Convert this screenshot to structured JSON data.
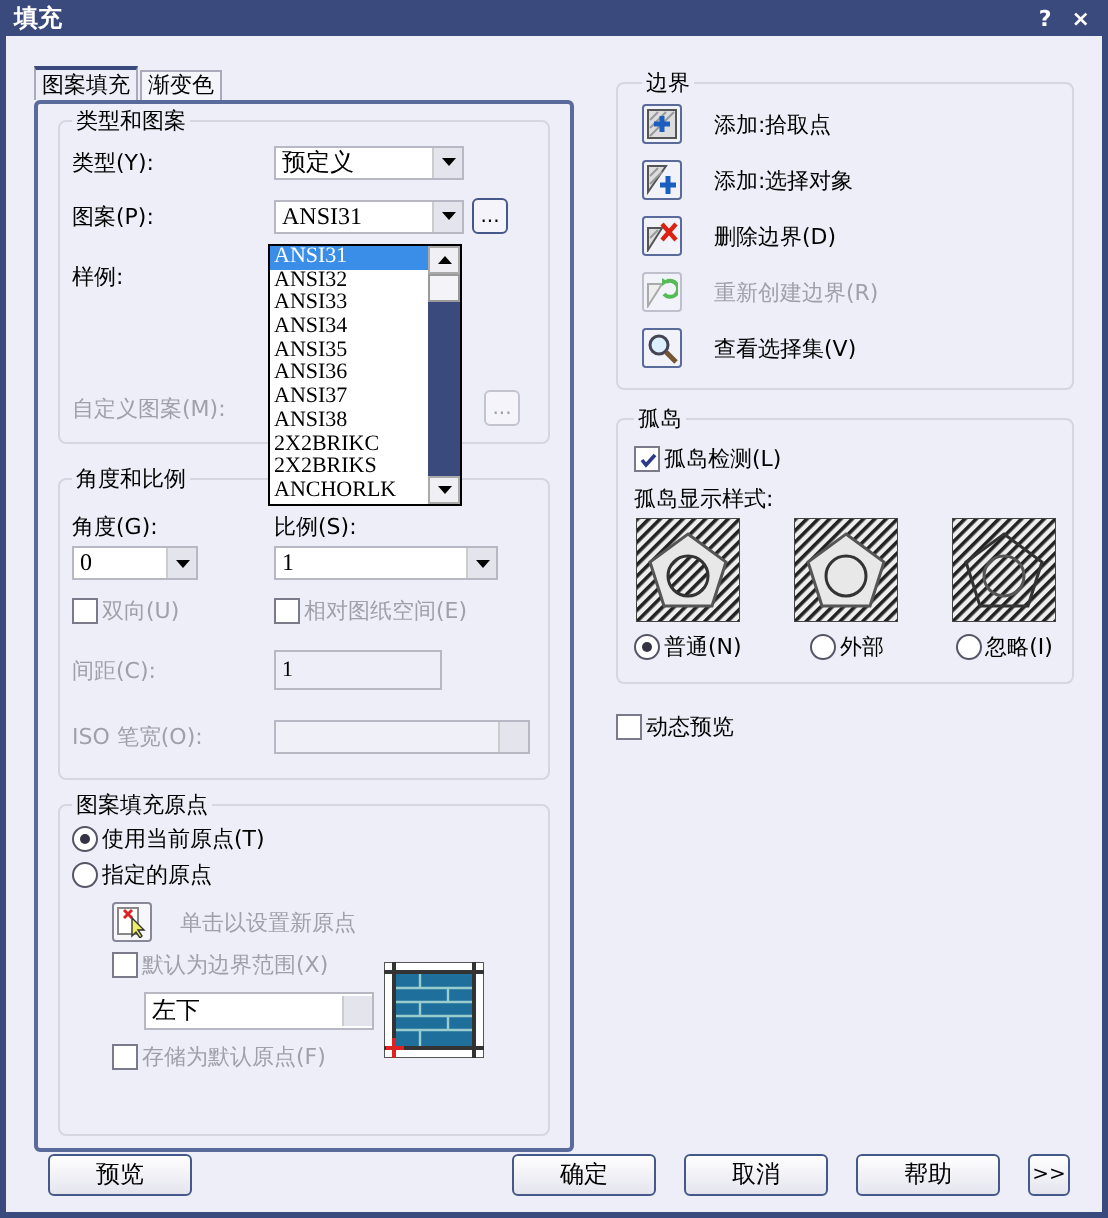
{
  "window": {
    "title": "填充",
    "help": "?",
    "close": "×"
  },
  "tabs": [
    {
      "label": "图案填充",
      "selected": true
    },
    {
      "label": "渐变色",
      "selected": false
    }
  ],
  "type_and_pattern": {
    "title": "类型和图案",
    "type": {
      "label": "类型(Y):",
      "value": "预定义"
    },
    "pattern": {
      "label": "图案(P):",
      "value": "ANSI31",
      "browse": "..."
    },
    "swatch": {
      "label": "样例:"
    },
    "custom_pattern": {
      "label": "自定义图案(M):",
      "disabled": true,
      "browse": "..."
    }
  },
  "pattern_dropdown": {
    "items": [
      {
        "label": "ANSI31",
        "selected": true
      },
      {
        "label": "ANSI32",
        "selected": false
      },
      {
        "label": "ANSI33",
        "selected": false
      },
      {
        "label": "ANSI34",
        "selected": false
      },
      {
        "label": "ANSI35",
        "selected": false
      },
      {
        "label": "ANSI36",
        "selected": false
      },
      {
        "label": "ANSI37",
        "selected": false
      },
      {
        "label": "ANSI38",
        "selected": false
      },
      {
        "label": "2X2BRIKC",
        "selected": false
      },
      {
        "label": "2X2BRIKS",
        "selected": false
      },
      {
        "label": "ANCHORLK",
        "selected": false
      }
    ]
  },
  "angle_scale": {
    "title": "角度和比例",
    "angle": {
      "label": "角度(G):",
      "value": "0"
    },
    "scale": {
      "label": "比例(S):",
      "value": "1"
    },
    "double": {
      "label": "双向(U)",
      "checked": false,
      "disabled": true
    },
    "relative": {
      "label": "相对图纸空间(E)",
      "checked": false,
      "disabled": true
    },
    "spacing": {
      "label": "间距(C):",
      "value": "1",
      "disabled": true
    },
    "iso_pen": {
      "label": "ISO 笔宽(O):",
      "disabled": true
    }
  },
  "origin": {
    "title": "图案填充原点",
    "options": [
      {
        "label": "使用当前原点(T)",
        "selected": true
      },
      {
        "label": "指定的原点",
        "selected": false
      }
    ],
    "click_set": {
      "label": "单击以设置新原点",
      "disabled": true
    },
    "default_extent": {
      "label": "默认为边界范围(X)",
      "checked": false,
      "disabled": true
    },
    "extent_value": "左下",
    "store_default": {
      "label": "存储为默认原点(F)",
      "checked": false,
      "disabled": true
    }
  },
  "boundaries": {
    "title": "边界",
    "actions": [
      {
        "label": "添加:拾取点",
        "kind": "pick",
        "disabled": false
      },
      {
        "label": "添加:选择对象",
        "kind": "select",
        "disabled": false
      },
      {
        "label": "删除边界(D)",
        "kind": "remove",
        "disabled": false
      },
      {
        "label": "重新创建边界(R)",
        "kind": "recreate",
        "disabled": true
      },
      {
        "label": "查看选择集(V)",
        "kind": "view",
        "disabled": false
      }
    ]
  },
  "islands": {
    "title": "孤岛",
    "detect": {
      "label": "孤岛检测(L)",
      "checked": true
    },
    "style_label": "孤岛显示样式:",
    "styles": [
      {
        "label": "普通(N)",
        "kind": "normal",
        "selected": true
      },
      {
        "label": "外部",
        "kind": "outer",
        "selected": false
      },
      {
        "label": "忽略(I)",
        "kind": "ignore",
        "selected": false
      }
    ]
  },
  "dynamic_preview": {
    "label": "动态预览",
    "checked": false
  },
  "buttons": {
    "preview": "预览",
    "ok": "确定",
    "cancel": "取消",
    "help": "帮助",
    "more": ">>"
  }
}
